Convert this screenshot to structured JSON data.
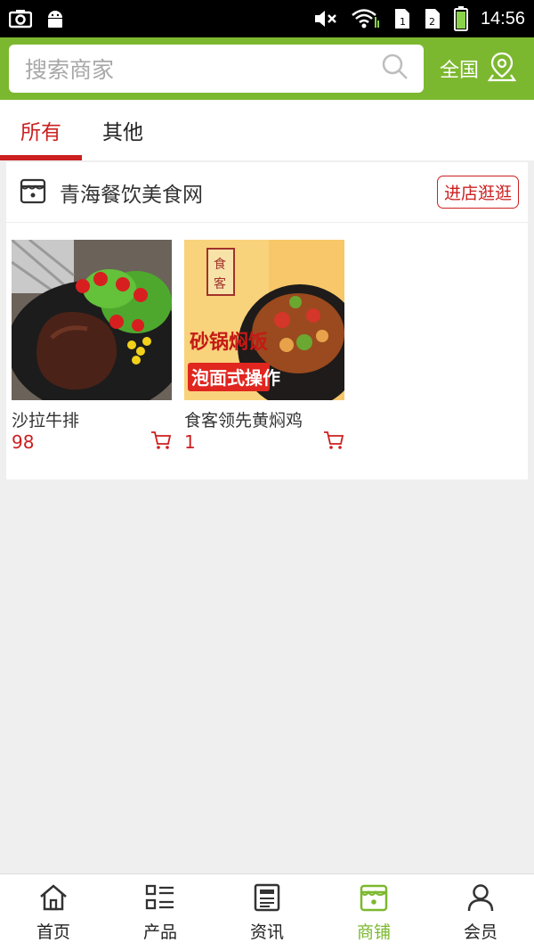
{
  "status_bar": {
    "time": "14:56",
    "left_icons": [
      "screenshot-icon",
      "android-icon"
    ],
    "right_icons": [
      "mute-icon",
      "wifi-icon",
      "sim1-icon",
      "sim2-icon",
      "battery-icon"
    ]
  },
  "header": {
    "search_placeholder": "搜索商家",
    "region_label": "全国",
    "accent_color": "#7cb82f"
  },
  "tabs": [
    {
      "label": "所有",
      "active": true
    },
    {
      "label": "其他",
      "active": false
    }
  ],
  "shop": {
    "name": "青海餐饮美食网",
    "visit_label": "进店逛逛",
    "products": [
      {
        "name": "沙拉牛排",
        "price": "98"
      },
      {
        "name": "食客领先黄焖鸡",
        "price": "1"
      }
    ]
  },
  "bottom_nav": [
    {
      "label": "首页",
      "icon": "home-icon"
    },
    {
      "label": "产品",
      "icon": "product-list-icon"
    },
    {
      "label": "资讯",
      "icon": "news-icon"
    },
    {
      "label": "商铺",
      "icon": "shop-icon",
      "active": true
    },
    {
      "label": "会员",
      "icon": "member-icon"
    }
  ],
  "colors": {
    "brand_red": "#cc1f1f",
    "brand_green": "#7cb82f"
  }
}
